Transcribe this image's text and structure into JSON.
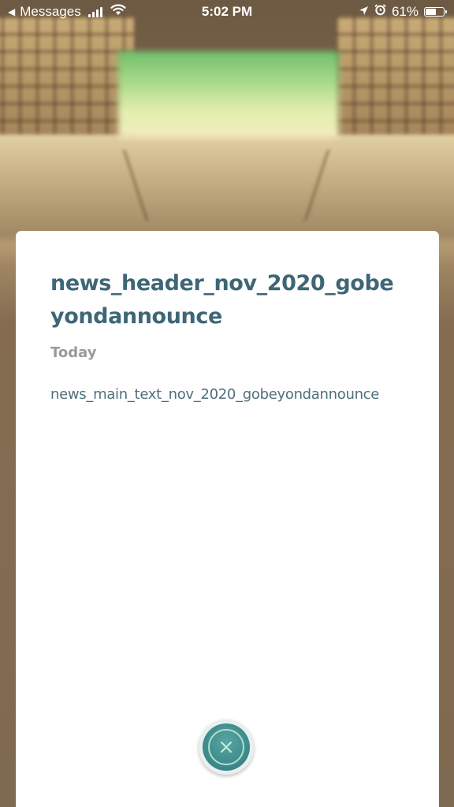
{
  "status_bar": {
    "back_app": "Messages",
    "back_glyph": "◀",
    "time": "5:02 PM",
    "battery_percent": "61%",
    "battery_level": 0.61,
    "icons": [
      "signal-icon",
      "wifi-icon",
      "location-icon",
      "alarm-icon",
      "battery-icon"
    ]
  },
  "news": {
    "title": "news_header_nov_2020_gobeyondannounce",
    "date": "Today",
    "body": "news_main_text_nov_2020_gobeyondannounce"
  },
  "close_button": {
    "icon": "close-icon"
  },
  "colors": {
    "title": "#3e6676",
    "date": "#9a9a9a",
    "body": "#4e6f7c",
    "close_accent": "#3e8a8c"
  }
}
